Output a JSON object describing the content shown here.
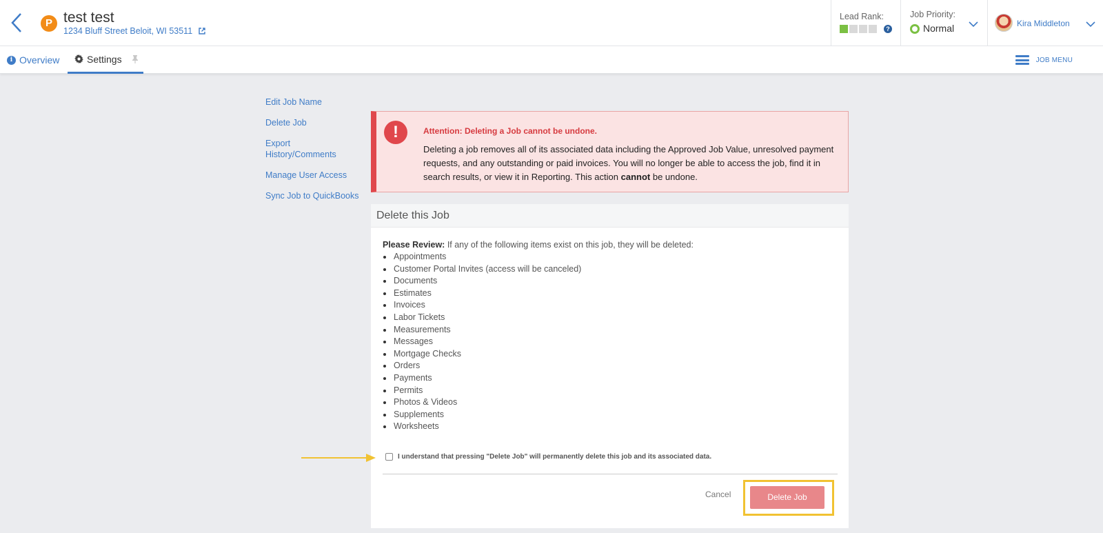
{
  "header": {
    "job_badge": "P",
    "job_title": "test test",
    "job_address": "1234 Bluff Street Beloit, WI 53511",
    "lead_rank_label": "Lead Rank:",
    "lead_rank_filled": 1,
    "lead_rank_total": 4,
    "help_glyph": "?",
    "job_priority_label": "Job Priority:",
    "job_priority_value": "Normal",
    "user_name": "Kira Middleton"
  },
  "tabs": {
    "overview_icon": "i",
    "overview": "Overview",
    "settings": "Settings",
    "job_menu": "JOB MENU"
  },
  "side_menu": {
    "edit_job_name": "Edit Job Name",
    "delete_job": "Delete Job",
    "export_history": "Export History/Comments",
    "manage_user_access": "Manage User Access",
    "sync_quickbooks": "Sync Job to QuickBooks"
  },
  "alert": {
    "icon": "!",
    "title": "Attention: Deleting a Job cannot be undone.",
    "body_before": "Deleting a job removes all of its associated data including the Approved Job Value, unresolved payment requests, and any outstanding or paid invoices. You will no longer be able to access the job, find it in search results, or view it in Reporting. This action ",
    "body_bold": "cannot",
    "body_after": " be undone."
  },
  "card": {
    "title": "Delete this Job",
    "review_label": "Please Review:",
    "review_text": " If any of the following items exist on this job, they will be deleted:",
    "items": [
      "Appointments",
      "Customer Portal Invites (access will be canceled)",
      "Documents",
      "Estimates",
      "Invoices",
      "Labor Tickets",
      "Measurements",
      "Messages",
      "Mortgage Checks",
      "Orders",
      "Payments",
      "Permits",
      "Photos & Videos",
      "Supplements",
      "Worksheets"
    ],
    "confirm_text": "I understand that pressing \"Delete Job\" will permanently delete this job and its associated data.",
    "cancel": "Cancel",
    "delete_button": "Delete Job"
  },
  "colors": {
    "accent": "#3f7cc7",
    "danger": "#e0474c",
    "highlight": "#f1c232",
    "delete_button": "#e8878a"
  }
}
